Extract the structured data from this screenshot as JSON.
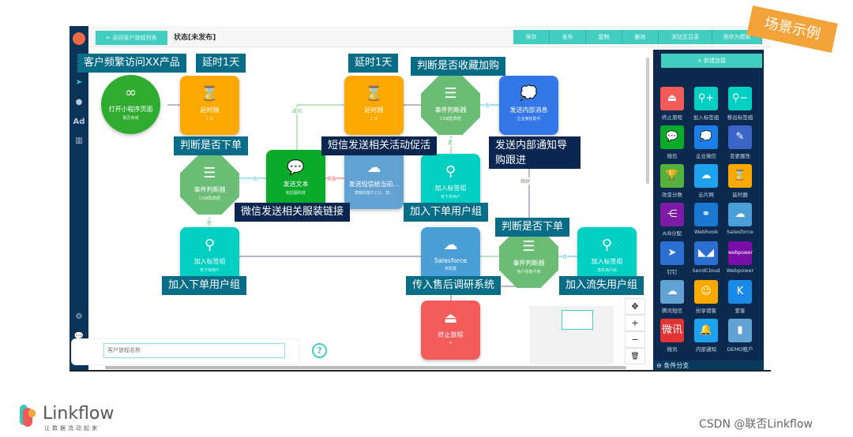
{
  "toolbar": {
    "back": "← 返回客户旅程列表",
    "status": "状态[未发布]",
    "buttons": [
      "保存",
      "发布",
      "复制",
      "删除",
      "添加至目录",
      "保存为模板"
    ]
  },
  "sidebar": {
    "items": [
      "1",
      "➤",
      "●",
      "Ad",
      "▥"
    ],
    "bottom": [
      "⚙",
      "💬",
      "👤"
    ]
  },
  "nodes": [
    {
      "title": "打开小程序页面",
      "sub": "联否商城",
      "icon": "mini-program-icon",
      "glyph": "∞",
      "color": "#2fac2f"
    },
    {
      "title": "延时器",
      "sub": "1 日",
      "icon": "hourglass-icon",
      "glyph": "⌛",
      "color": "#fba800"
    },
    {
      "title": "事件判断器",
      "sub": "CK销售数据",
      "icon": "list-icon",
      "glyph": "☰",
      "color": "#6bbd76"
    },
    {
      "title": "发送文本",
      "sub": "帕拉图科技",
      "icon": "wechat-icon",
      "glyph": "💬",
      "color": "#0aab2a"
    },
    {
      "title": "发送短信给当前...",
      "sub": "尊敬的客户{1}，您...",
      "icon": "cloud-icon",
      "glyph": "☁",
      "color": "#62a2d3"
    },
    {
      "title": "延时器",
      "sub": "1 日",
      "icon": "hourglass-icon",
      "glyph": "⌛",
      "color": "#fba800"
    },
    {
      "title": "事件判断器",
      "sub": "CK销售数据",
      "icon": "list-icon",
      "glyph": "☰",
      "color": "#6bbd76"
    },
    {
      "title": "发送内部消息",
      "sub": "企业微信助手",
      "icon": "chat-icon",
      "glyph": "💭",
      "color": "#3478e8"
    },
    {
      "title": "加入标签组",
      "sub": "有下单用户",
      "icon": "user-add-icon",
      "glyph": "⚲",
      "color": "#00cfc1"
    },
    {
      "title": "加入标签组",
      "sub": "有下单用户",
      "icon": "user-add-icon",
      "glyph": "⚲",
      "color": "#00cfc1"
    },
    {
      "title": "Salesforce",
      "sub": "未配置",
      "icon": "salesforce-cloud-icon",
      "glyph": "☁",
      "color": "#4aa0d6"
    },
    {
      "title": "事件判断器",
      "sub": "用户核销卡券",
      "icon": "list-icon",
      "glyph": "☰",
      "color": "#6bbd76"
    },
    {
      "title": "加入标签组",
      "sub": "流失用户组",
      "icon": "user-add-icon",
      "glyph": "⚲",
      "color": "#00cfc1"
    },
    {
      "title": "终止旅程",
      "sub": "✈",
      "icon": "stop-icon",
      "glyph": "⏏",
      "color": "#f45b5b"
    }
  ],
  "edge_labels": [
    "成功",
    "否",
    "失败",
    "是",
    "否",
    "是",
    "否",
    "继续"
  ],
  "callouts": [
    "客户频繁访问XX产品",
    "延时1天",
    "延时1天",
    "判断是否收藏加购",
    "判断是否下单",
    "短信发送相关活动促活",
    "发送内部通知导购跟进",
    "微信发送相关服装链接",
    "加入下单用户组",
    "判断是否下单",
    "加入下单用户组",
    "传入售后调研系统",
    "加入流失用户组"
  ],
  "panel": {
    "new_connection": "+ 新建连接",
    "section": "条件分支",
    "items": [
      {
        "label": "终止旅程",
        "color": "#f25a5a",
        "glyph": "⏏",
        "icon": "stop-icon"
      },
      {
        "label": "加入标签组",
        "color": "#00cfc1",
        "glyph": "⚲+",
        "icon": "user-add-icon"
      },
      {
        "label": "移出标签组",
        "color": "#00cfc1",
        "glyph": "⚲−",
        "icon": "user-remove-icon"
      },
      {
        "label": "微信",
        "color": "#0aab2a",
        "glyph": "💬",
        "icon": "wechat-icon"
      },
      {
        "label": "企业微信",
        "color": "#1b7fe8",
        "glyph": "💭",
        "icon": "work-wechat-icon"
      },
      {
        "label": "变更属性",
        "color": "#3a64c8",
        "glyph": "✎",
        "icon": "edit-icon"
      },
      {
        "label": "改变分数",
        "color": "#56b13c",
        "glyph": "🏆",
        "icon": "trophy-icon"
      },
      {
        "label": "云片网",
        "color": "#1ea2ef",
        "glyph": "☁",
        "icon": "cloud-icon"
      },
      {
        "label": "延时器",
        "color": "#fba800",
        "glyph": "⌛",
        "icon": "hourglass-icon"
      },
      {
        "label": "A/B分配",
        "color": "#7d1ba8",
        "glyph": "⋲",
        "icon": "ab-split-icon"
      },
      {
        "label": "Webhook",
        "color": "#1978d2",
        "glyph": "⚭",
        "icon": "webhook-icon"
      },
      {
        "label": "Salesforce",
        "color": "#4aa0d6",
        "glyph": "☁",
        "icon": "salesforce-icon"
      },
      {
        "label": "钉钉",
        "color": "#2a6fd1",
        "glyph": "➤",
        "icon": "dingtalk-icon"
      },
      {
        "label": "SendCloud",
        "color": "#2a6fd1",
        "glyph": "◣◢",
        "icon": "sendcloud-icon"
      },
      {
        "label": "Webpower",
        "color": "#7a0fa8",
        "glyph": "webpower",
        "icon": "webpower-icon"
      },
      {
        "label": "腾讯短信",
        "color": "#62a2d3",
        "glyph": "☁",
        "icon": "tencent-sms-icon"
      },
      {
        "label": "纷享销客",
        "color": "#fba800",
        "glyph": "☺",
        "icon": "fxiaoke-icon"
      },
      {
        "label": "爱客",
        "color": "#1a8ae8",
        "glyph": "K",
        "icon": "aike-icon"
      },
      {
        "label": "微讯",
        "color": "#e23333",
        "glyph": "微讯",
        "icon": "weixun-icon"
      },
      {
        "label": "内部通知",
        "color": "#1ea2ef",
        "glyph": "🔔",
        "icon": "bell-icon"
      },
      {
        "label": "DEMO租户",
        "color": "#62a2d3",
        "glyph": "▮",
        "icon": "demo-tenant-icon"
      }
    ]
  },
  "footer": {
    "name_placeholder": "客户旅程名称",
    "help": "?"
  },
  "controls": [
    "✥",
    "+",
    "−",
    "🗑"
  ],
  "stamp": "场景示例",
  "logo": {
    "name": "Linkflow",
    "slogan": "让数据流动起来"
  },
  "watermark": "CSDN @联否Linkflow"
}
